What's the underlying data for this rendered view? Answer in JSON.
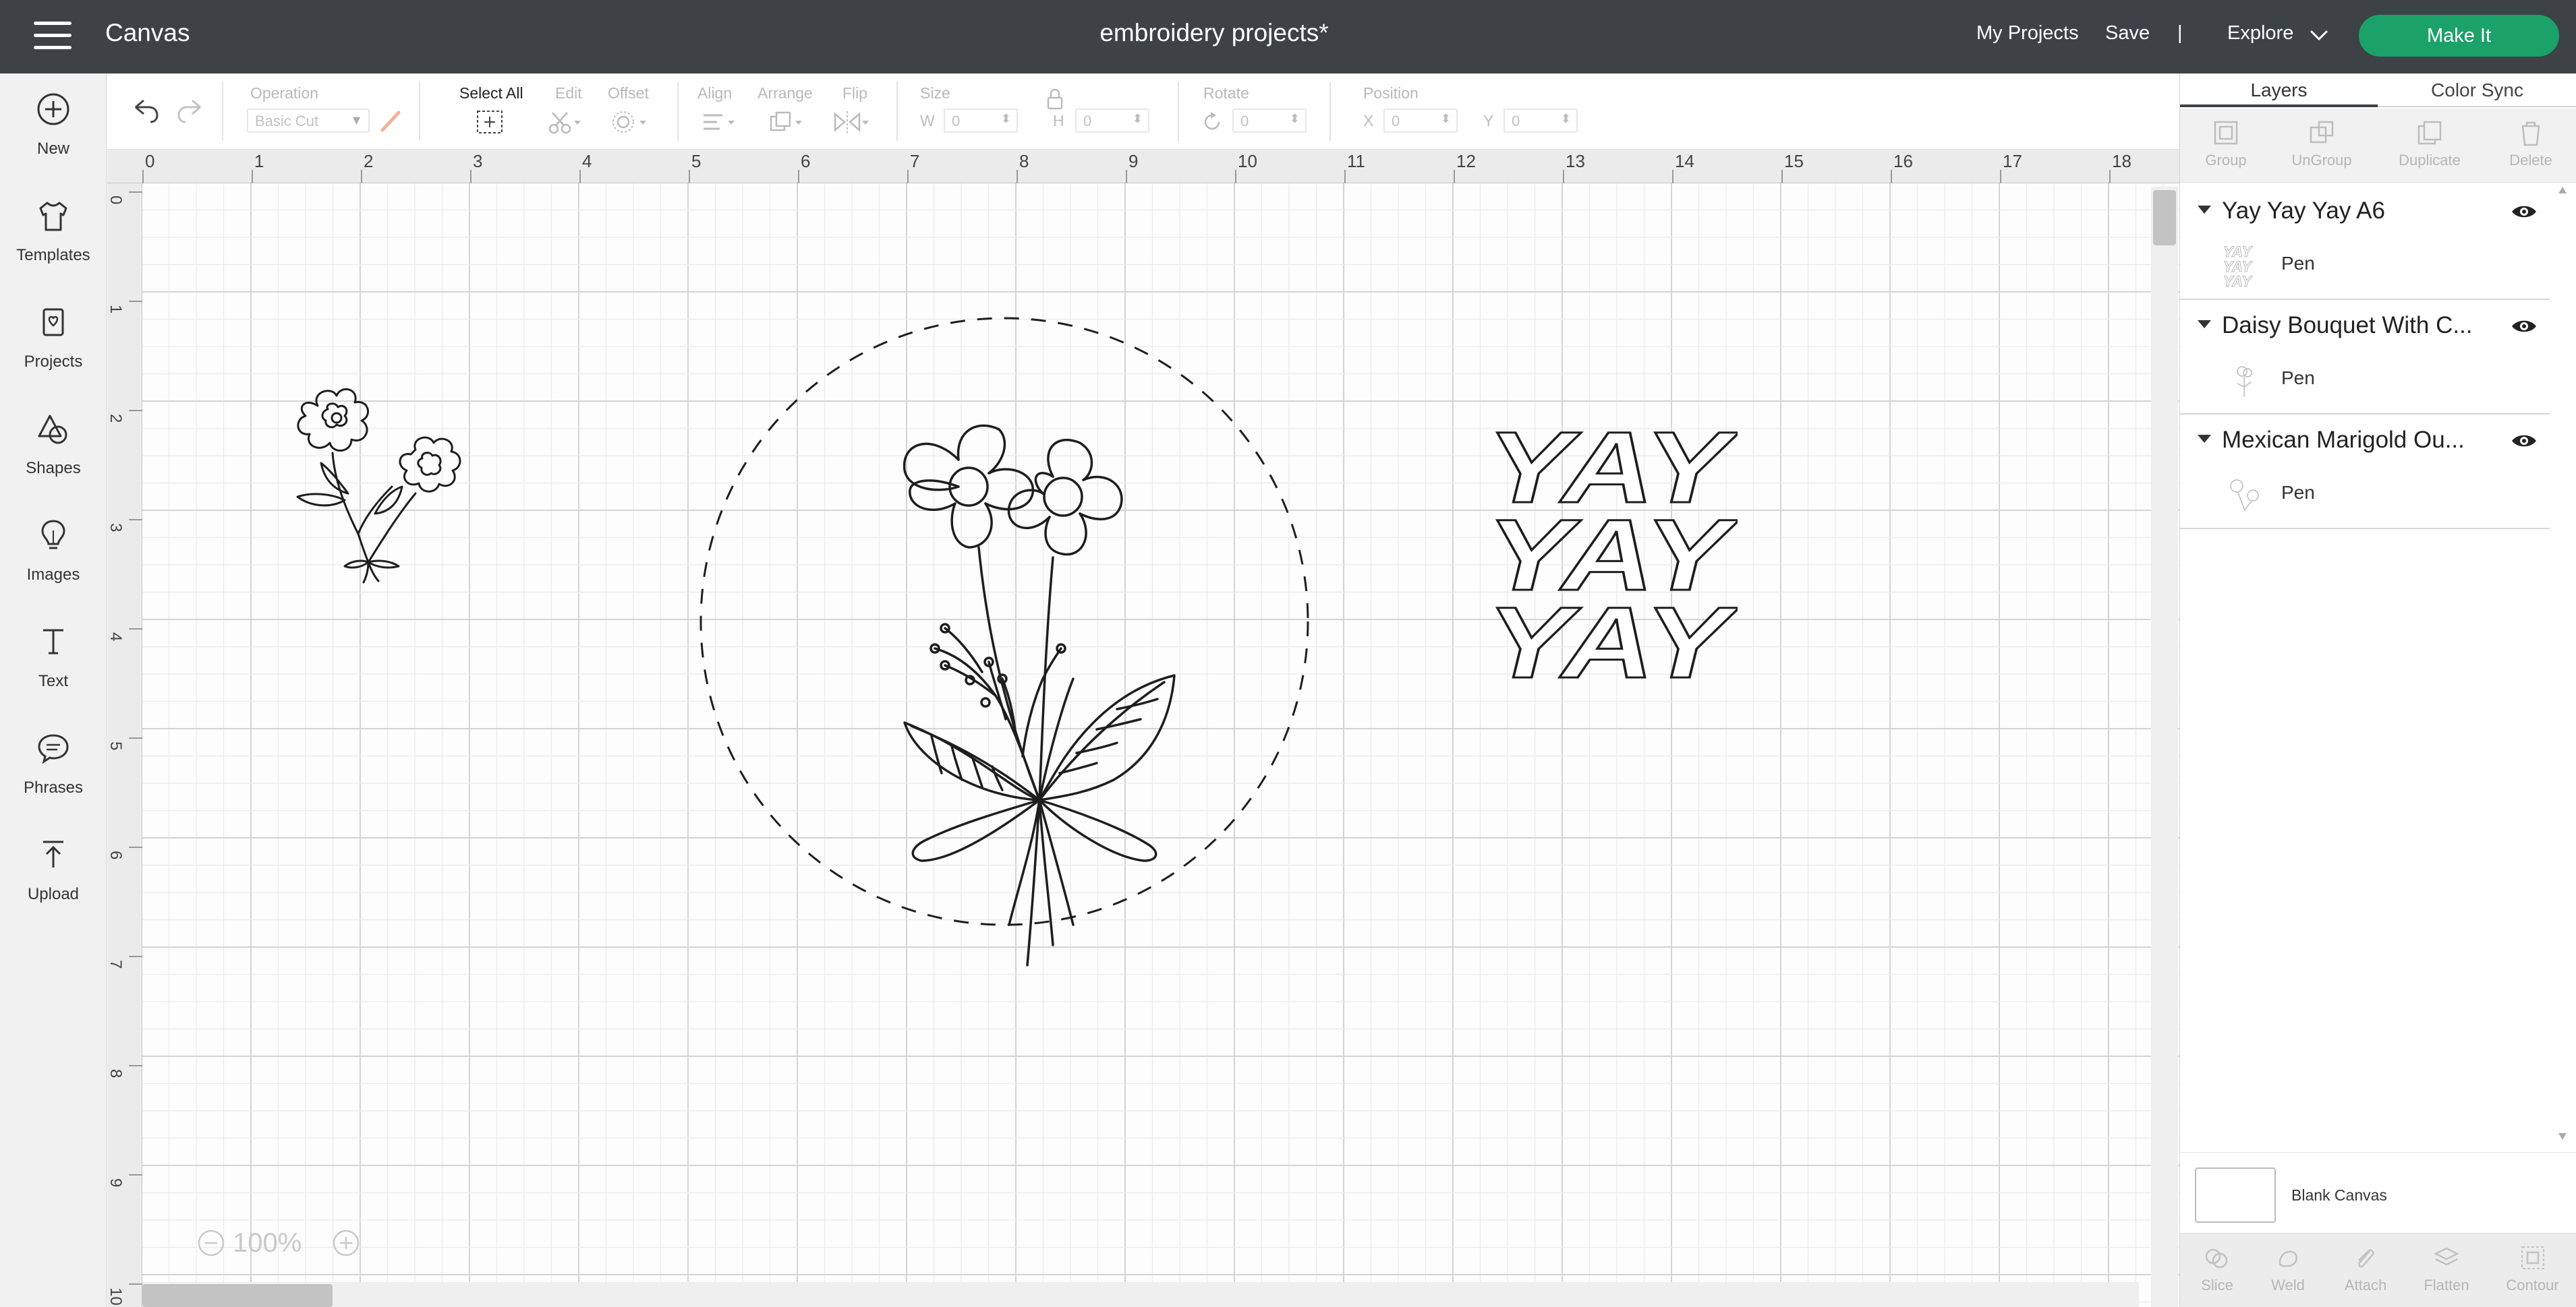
{
  "header": {
    "app_title": "Canvas",
    "project_title": "embroidery projects*",
    "my_projects": "My Projects",
    "save": "Save",
    "separator": "|",
    "explore": "Explore",
    "make_it": "Make It"
  },
  "sidebar": {
    "items": [
      {
        "label": "New",
        "icon": "plus-circle-icon"
      },
      {
        "label": "Templates",
        "icon": "shirt-icon"
      },
      {
        "label": "Projects",
        "icon": "projects-icon"
      },
      {
        "label": "Shapes",
        "icon": "shapes-icon"
      },
      {
        "label": "Images",
        "icon": "lightbulb-icon"
      },
      {
        "label": "Text",
        "icon": "text-icon"
      },
      {
        "label": "Phrases",
        "icon": "speech-bubble-icon"
      },
      {
        "label": "Upload",
        "icon": "upload-icon"
      }
    ]
  },
  "toolbar": {
    "operation_label": "Operation",
    "operation_value": "Basic Cut",
    "select_all_label": "Select All",
    "edit_label": "Edit",
    "offset_label": "Offset",
    "align_label": "Align",
    "arrange_label": "Arrange",
    "flip_label": "Flip",
    "size_label": "Size",
    "w_label": "W",
    "w_value": "0",
    "h_label": "H",
    "h_value": "0",
    "rotate_label": "Rotate",
    "rotate_value": "0",
    "position_label": "Position",
    "x_label": "X",
    "x_value": "0",
    "y_label": "Y",
    "y_value": "0"
  },
  "canvas": {
    "ruler_h": [
      "0",
      "1",
      "2",
      "3",
      "4",
      "5",
      "6",
      "7",
      "8",
      "9",
      "10",
      "11",
      "12",
      "13",
      "14",
      "15",
      "16",
      "17",
      "18"
    ],
    "ruler_v": [
      "0",
      "1",
      "2",
      "3",
      "4",
      "5",
      "6",
      "7",
      "8",
      "9",
      "10"
    ],
    "zoom": "100%",
    "yay_text": "YAY"
  },
  "right_panel": {
    "tabs": [
      "Layers",
      "Color Sync"
    ],
    "actions": [
      "Group",
      "UnGroup",
      "Duplicate",
      "Delete"
    ],
    "layers": [
      {
        "name": "Yay Yay Yay A6",
        "sub": "Pen"
      },
      {
        "name": "Daisy Bouquet With C...",
        "sub": "Pen"
      },
      {
        "name": "Mexican Marigold Ou...",
        "sub": "Pen"
      }
    ],
    "blank_canvas": "Blank Canvas",
    "bottom_actions": [
      "Slice",
      "Weld",
      "Attach",
      "Flatten",
      "Contour"
    ]
  },
  "colors": {
    "header_bg": "#3c4246",
    "make_it": "#1aa269",
    "canvas_bg": "#fdfdfd",
    "grid_minor": "#ececec",
    "grid_major": "#d4d4d4",
    "drawing_stroke": "#1e1e1e"
  }
}
